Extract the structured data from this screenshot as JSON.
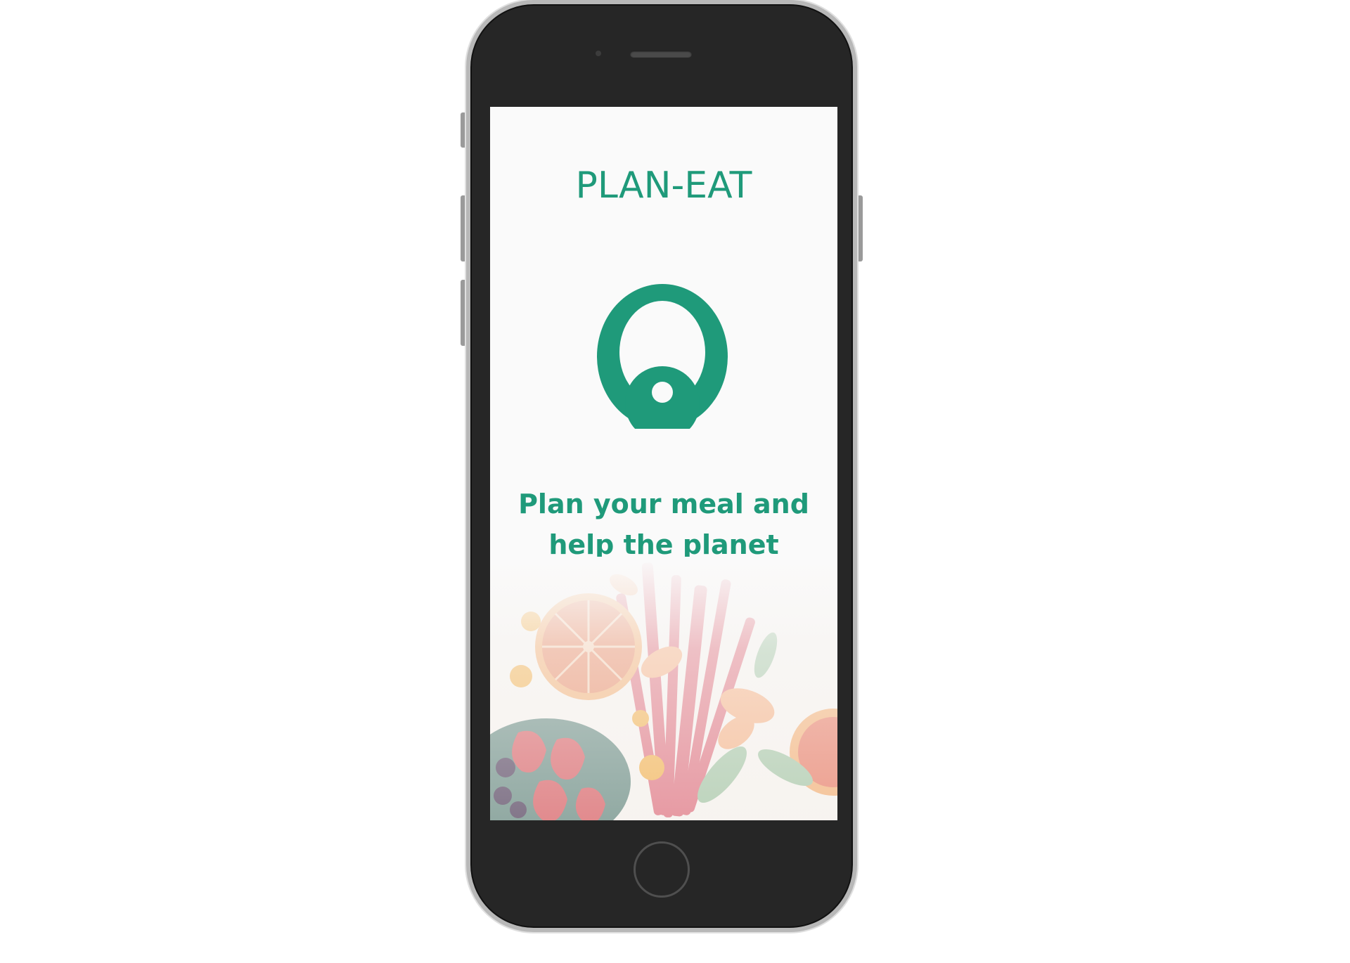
{
  "app": {
    "title": "PLAN-EAT",
    "tagline": "Plan your meal and help the planet"
  },
  "colors": {
    "brand_green": "#1f9a7a",
    "phone_body": "#262626",
    "phone_frame": "#b8b8b8",
    "screen_bg": "#fafafa"
  },
  "icons": {
    "logo": "plan-eat-logo-icon",
    "home": "home-button-icon"
  }
}
